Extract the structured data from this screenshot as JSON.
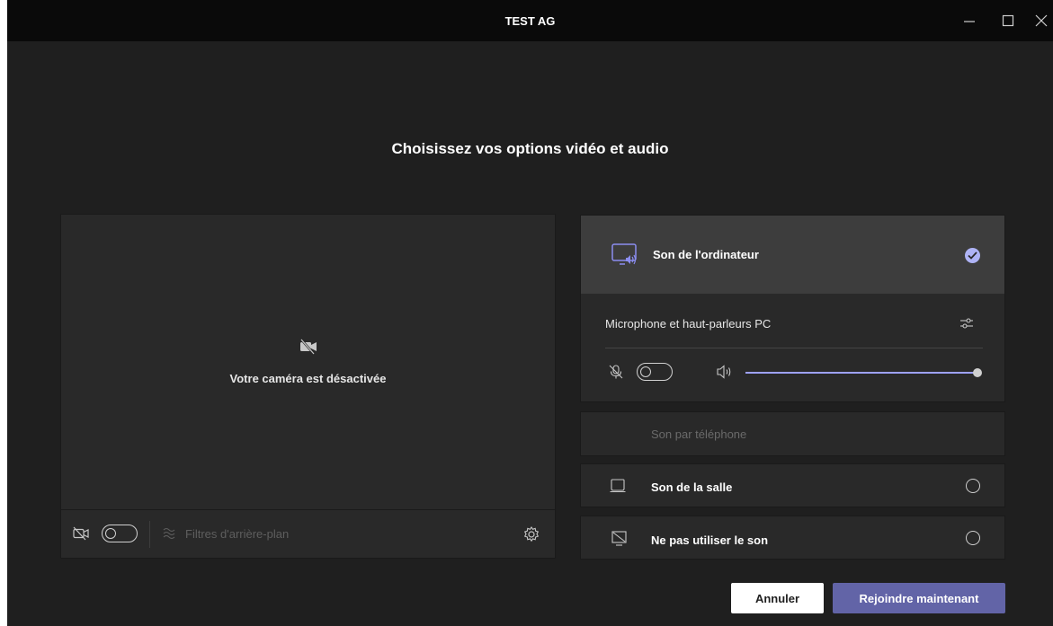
{
  "window": {
    "title": "TEST AG",
    "controls": [
      "minimize",
      "maximize",
      "close"
    ]
  },
  "heading": "Choisissez vos options vidéo et audio",
  "video": {
    "camera_off_text": "Votre caméra est désactivée",
    "background_filters_label": "Filtres d'arrière-plan",
    "camera_toggle_on": false
  },
  "audio": {
    "computer_sound": {
      "label": "Son de l'ordinateur",
      "selected": true,
      "device_label": "Microphone et haut-parleurs PC",
      "mic_toggle_on": false,
      "speaker_volume": 1.0
    },
    "phone_sound": {
      "label": "Son par téléphone",
      "enabled": false
    },
    "room_sound": {
      "label": "Son de la salle",
      "selected": false
    },
    "no_sound": {
      "label": "Ne pas utiliser le son",
      "selected": false
    }
  },
  "actions": {
    "cancel_label": "Annuler",
    "join_label": "Rejoindre maintenant"
  },
  "colors": {
    "accent": "#6264a7",
    "check": "#aeb3f5",
    "slider": "#9ea2ff",
    "background": "#1f1f1f",
    "panel": "#292929"
  }
}
